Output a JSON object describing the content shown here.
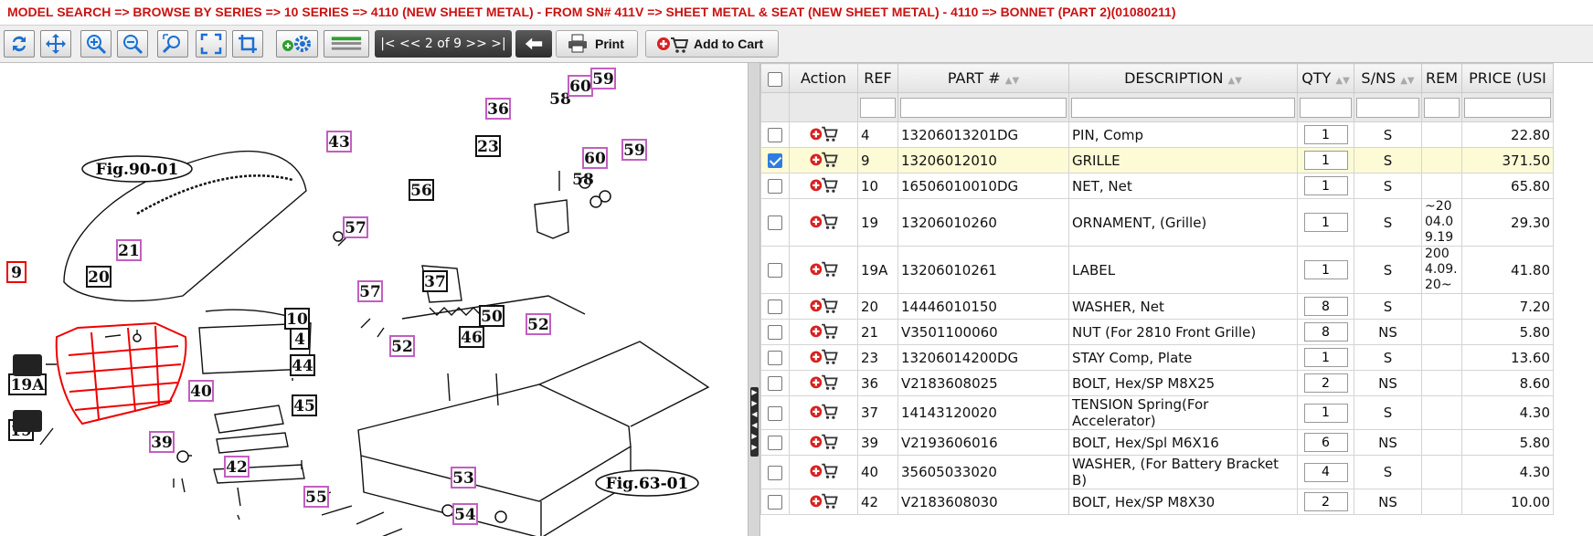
{
  "breadcrumb": "MODEL SEARCH  => BROWSE BY SERIES  => 10 SERIES  => 4110 (NEW SHEET METAL) - FROM SN# 411V  => SHEET METAL & SEAT (NEW SHEET METAL) - 4110  => BONNET (PART 2)(01080211)",
  "pager": {
    "first": "|<",
    "prev": "<<",
    "current": "2",
    "of": "of",
    "total": "9",
    "next": ">>",
    "last": ">|"
  },
  "buttons": {
    "print": "Print",
    "add_to_cart": "Add to Cart"
  },
  "colors": {
    "breadcrumb": "#cc1111",
    "highlight": "#ee0000",
    "callout": "#c25fc2",
    "selected_row": "#fdfbd5"
  },
  "diagram": {
    "fig_top": "Fig.90-01",
    "fig_bottom": "Fig.63-01",
    "labels": [
      "9",
      "19A",
      "19",
      "20",
      "21",
      "43",
      "36",
      "58",
      "60",
      "59",
      "23",
      "60",
      "58",
      "59",
      "56",
      "57",
      "57",
      "37",
      "10",
      "4",
      "44",
      "45",
      "40",
      "39",
      "42",
      "50",
      "46",
      "52",
      "52",
      "55",
      "53",
      "54"
    ]
  },
  "table": {
    "headers": {
      "action": "Action",
      "ref": "REF",
      "part": "PART #",
      "desc": "DESCRIPTION",
      "qty": "QTY",
      "sns": "S/NS",
      "rem": "REM",
      "price": "PRICE (USI"
    },
    "rows": [
      {
        "ref": "4",
        "part": "13206013201DG",
        "desc": "PIN, Comp",
        "qty": "1",
        "sns": "S",
        "rem": "",
        "price": "22.80",
        "checked": false
      },
      {
        "ref": "9",
        "part": "13206012010",
        "desc": "GRILLE",
        "qty": "1",
        "sns": "S",
        "rem": "",
        "price": "371.50",
        "checked": true
      },
      {
        "ref": "10",
        "part": "16506010010DG",
        "desc": "NET, Net",
        "qty": "1",
        "sns": "S",
        "rem": "",
        "price": "65.80",
        "checked": false
      },
      {
        "ref": "19",
        "part": "13206010260",
        "desc": "ORNAMENT, (Grille)",
        "qty": "1",
        "sns": "S",
        "rem": "~2004.09.19",
        "price": "29.30",
        "checked": false
      },
      {
        "ref": "19A",
        "part": "13206010261",
        "desc": "LABEL",
        "qty": "1",
        "sns": "S",
        "rem": "2004.09.20~",
        "price": "41.80",
        "checked": false
      },
      {
        "ref": "20",
        "part": "14446010150",
        "desc": "WASHER, Net",
        "qty": "8",
        "sns": "S",
        "rem": "",
        "price": "7.20",
        "checked": false
      },
      {
        "ref": "21",
        "part": "V3501100060",
        "desc": "NUT (For 2810 Front Grille)",
        "qty": "8",
        "sns": "NS",
        "rem": "",
        "price": "5.80",
        "checked": false
      },
      {
        "ref": "23",
        "part": "13206014200DG",
        "desc": "STAY Comp, Plate",
        "qty": "1",
        "sns": "S",
        "rem": "",
        "price": "13.60",
        "checked": false
      },
      {
        "ref": "36",
        "part": "V2183608025",
        "desc": "BOLT, Hex/SP M8X25",
        "qty": "2",
        "sns": "NS",
        "rem": "",
        "price": "8.60",
        "checked": false
      },
      {
        "ref": "37",
        "part": "14143120020",
        "desc": "TENSION Spring(For Accelerator)",
        "qty": "1",
        "sns": "S",
        "rem": "",
        "price": "4.30",
        "checked": false
      },
      {
        "ref": "39",
        "part": "V2193606016",
        "desc": "BOLT, Hex/Spl M6X16",
        "qty": "6",
        "sns": "NS",
        "rem": "",
        "price": "5.80",
        "checked": false
      },
      {
        "ref": "40",
        "part": "35605033020",
        "desc": "WASHER, (For Battery Bracket B)",
        "qty": "4",
        "sns": "S",
        "rem": "",
        "price": "4.30",
        "checked": false
      },
      {
        "ref": "42",
        "part": "V2183608030",
        "desc": "BOLT, Hex/SP M8X30",
        "qty": "2",
        "sns": "NS",
        "rem": "",
        "price": "10.00",
        "checked": false
      }
    ]
  }
}
